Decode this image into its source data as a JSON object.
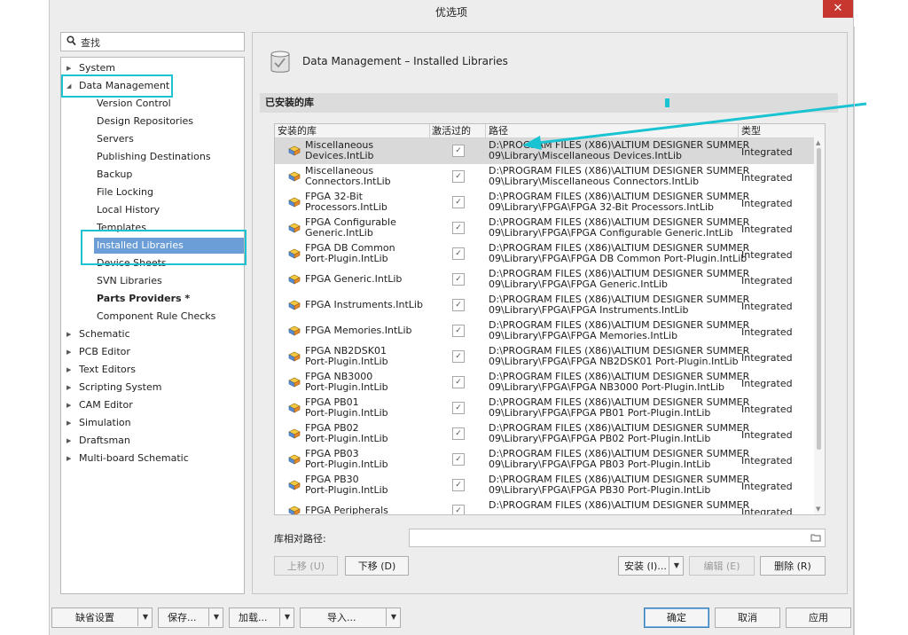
{
  "window": {
    "title": "优选项",
    "close_symbol": "✕"
  },
  "search": {
    "placeholder": "查找"
  },
  "tree": {
    "system": "System",
    "data_management": "Data Management",
    "dm_children": [
      "Version Control",
      "Design Repositories",
      "Servers",
      "Publishing Destinations",
      "Backup",
      "File Locking",
      "Local History",
      "Templates",
      "Installed Libraries",
      "Device Sheets",
      "SVN Libraries",
      "Parts Providers *",
      "Component Rule Checks"
    ],
    "other_nodes": [
      "Schematic",
      "PCB Editor",
      "Text Editors",
      "Scripting System",
      "CAM Editor",
      "Simulation",
      "Draftsman",
      "Multi-board Schematic"
    ]
  },
  "panel": {
    "title": "Data Management – Installed Libraries",
    "section": "已安装的库",
    "columns": [
      "安装的库",
      "激活过的",
      "路径",
      "类型"
    ],
    "libraries": [
      {
        "name1": "Miscellaneous",
        "name2": "Devices.IntLib",
        "path1": "D:\\PROGRAM FILES (X86)\\ALTIUM DESIGNER SUMMER",
        "path2": "09\\Library\\Miscellaneous Devices.IntLib",
        "type": "Integrated",
        "check": "✓"
      },
      {
        "name1": "Miscellaneous",
        "name2": "Connectors.IntLib",
        "path1": "D:\\PROGRAM FILES (X86)\\ALTIUM DESIGNER SUMMER",
        "path2": "09\\Library\\Miscellaneous Connectors.IntLib",
        "type": "Integrated",
        "check": "✓"
      },
      {
        "name1": "FPGA 32-Bit",
        "name2": "Processors.IntLib",
        "path1": "D:\\PROGRAM FILES (X86)\\ALTIUM DESIGNER SUMMER",
        "path2": "09\\Library\\FPGA\\FPGA 32-Bit Processors.IntLib",
        "type": "Integrated",
        "check": "✓"
      },
      {
        "name1": "FPGA Configurable",
        "name2": "Generic.IntLib",
        "path1": "D:\\PROGRAM FILES (X86)\\ALTIUM DESIGNER SUMMER",
        "path2": "09\\Library\\FPGA\\FPGA Configurable Generic.IntLib",
        "type": "Integrated",
        "check": "✓"
      },
      {
        "name1": "FPGA DB Common",
        "name2": "Port-Plugin.IntLib",
        "path1": "D:\\PROGRAM FILES (X86)\\ALTIUM DESIGNER SUMMER",
        "path2": "09\\Library\\FPGA\\FPGA DB Common Port-Plugin.IntLib",
        "type": "Integrated",
        "check": "✓"
      },
      {
        "name1": "FPGA Generic.IntLib",
        "name2": "",
        "path1": "D:\\PROGRAM FILES (X86)\\ALTIUM DESIGNER SUMMER",
        "path2": "09\\Library\\FPGA\\FPGA Generic.IntLib",
        "type": "Integrated",
        "check": "✓"
      },
      {
        "name1": "FPGA Instruments.IntLib",
        "name2": "",
        "path1": "D:\\PROGRAM FILES (X86)\\ALTIUM DESIGNER SUMMER",
        "path2": "09\\Library\\FPGA\\FPGA Instruments.IntLib",
        "type": "Integrated",
        "check": "✓"
      },
      {
        "name1": "FPGA Memories.IntLib",
        "name2": "",
        "path1": "D:\\PROGRAM FILES (X86)\\ALTIUM DESIGNER SUMMER",
        "path2": "09\\Library\\FPGA\\FPGA Memories.IntLib",
        "type": "Integrated",
        "check": "✓"
      },
      {
        "name1": "FPGA NB2DSK01",
        "name2": "Port-Plugin.IntLib",
        "path1": "D:\\PROGRAM FILES (X86)\\ALTIUM DESIGNER SUMMER",
        "path2": "09\\Library\\FPGA\\FPGA NB2DSK01 Port-Plugin.IntLib",
        "type": "Integrated",
        "check": "✓"
      },
      {
        "name1": "FPGA NB3000",
        "name2": "Port-Plugin.IntLib",
        "path1": "D:\\PROGRAM FILES (X86)\\ALTIUM DESIGNER SUMMER",
        "path2": "09\\Library\\FPGA\\FPGA NB3000 Port-Plugin.IntLib",
        "type": "Integrated",
        "check": "✓"
      },
      {
        "name1": "FPGA PB01",
        "name2": "Port-Plugin.IntLib",
        "path1": "D:\\PROGRAM FILES (X86)\\ALTIUM DESIGNER SUMMER",
        "path2": "09\\Library\\FPGA\\FPGA PB01 Port-Plugin.IntLib",
        "type": "Integrated",
        "check": "✓"
      },
      {
        "name1": "FPGA PB02",
        "name2": "Port-Plugin.IntLib",
        "path1": "D:\\PROGRAM FILES (X86)\\ALTIUM DESIGNER SUMMER",
        "path2": "09\\Library\\FPGA\\FPGA PB02 Port-Plugin.IntLib",
        "type": "Integrated",
        "check": "✓"
      },
      {
        "name1": "FPGA PB03",
        "name2": "Port-Plugin.IntLib",
        "path1": "D:\\PROGRAM FILES (X86)\\ALTIUM DESIGNER SUMMER",
        "path2": "09\\Library\\FPGA\\FPGA PB03 Port-Plugin.IntLib",
        "type": "Integrated",
        "check": "✓"
      },
      {
        "name1": "FPGA PB30",
        "name2": "Port-Plugin.IntLib",
        "path1": "D:\\PROGRAM FILES (X86)\\ALTIUM DESIGNER SUMMER",
        "path2": "09\\Library\\FPGA\\FPGA PB30 Port-Plugin.IntLib",
        "type": "Integrated",
        "check": "✓"
      },
      {
        "name1": "FPGA Peripherals",
        "name2": "",
        "path1": "D:\\PROGRAM FILES (X86)\\ALTIUM DESIGNER SUMMER",
        "path2": "",
        "type": "Integrated",
        "check": "✓"
      }
    ],
    "relative_path_label": "库相对路径:",
    "relative_path_value": "",
    "buttons": {
      "move_up": "上移 (U)",
      "move_down": "下移 (D)",
      "install": "安装 (I)...",
      "edit": "编辑 (E)",
      "remove": "删除 (R)"
    }
  },
  "footer": {
    "defaults": "缺省设置",
    "save": "保存...",
    "load": "加载...",
    "import": "导入...",
    "ok": "确定",
    "cancel": "取消",
    "apply": "应用"
  },
  "colors": {
    "accent_highlight": "#19c3d2",
    "selection": "#6b9ed6",
    "close": "#c7372f"
  }
}
